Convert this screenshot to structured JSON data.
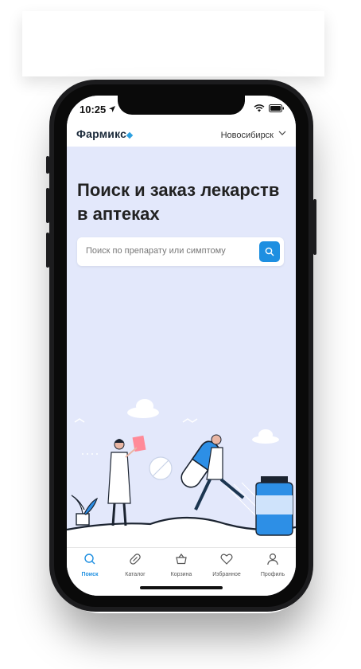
{
  "status_bar": {
    "time": "10:25"
  },
  "header": {
    "logo": "Фармикс",
    "city": "Новосибирск"
  },
  "hero": {
    "title": "Поиск и заказ лекарств в аптеках"
  },
  "search": {
    "placeholder": "Поиск по препарату или симптому"
  },
  "tabs": [
    {
      "label": "Поиск",
      "icon": "search-icon",
      "active": true
    },
    {
      "label": "Каталог",
      "icon": "pill-icon",
      "active": false
    },
    {
      "label": "Корзина",
      "icon": "basket-icon",
      "active": false
    },
    {
      "label": "Избранное",
      "icon": "heart-icon",
      "active": false
    },
    {
      "label": "Профиль",
      "icon": "person-icon",
      "active": false
    }
  ],
  "colors": {
    "accent": "#1e8fe1",
    "hero_bg": "#e3e8fb",
    "logo_dot": "#2da0e0"
  }
}
